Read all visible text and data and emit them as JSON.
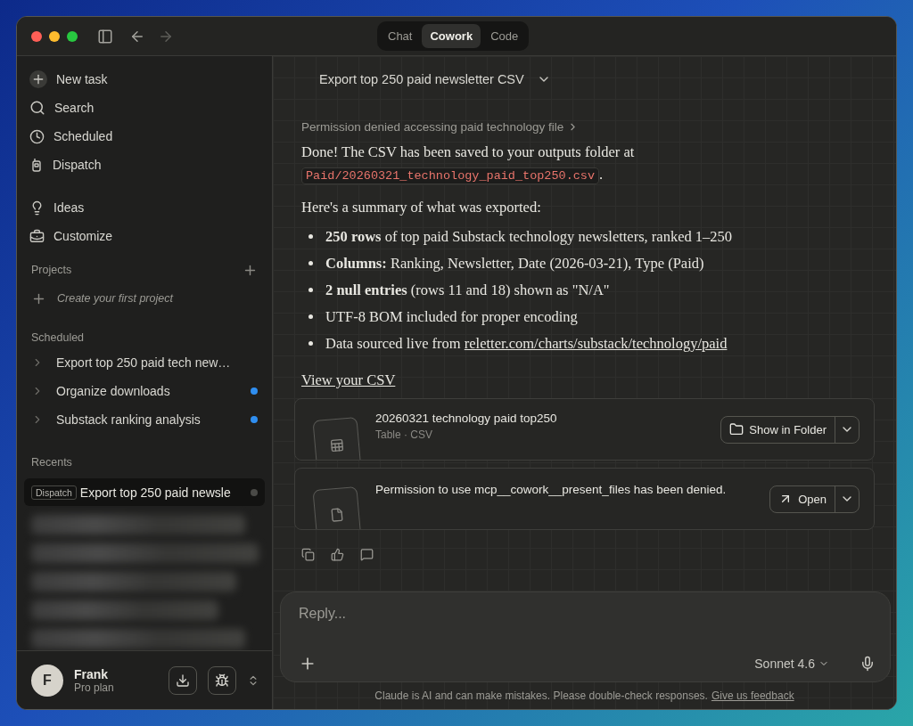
{
  "mode_tabs": [
    {
      "label": "Chat",
      "selected": false
    },
    {
      "label": "Cowork",
      "selected": true
    },
    {
      "label": "Code",
      "selected": false
    }
  ],
  "sidebar": {
    "actions": [
      {
        "label": "New task",
        "kind": "new"
      },
      {
        "label": "Search",
        "kind": "search"
      },
      {
        "label": "Scheduled",
        "kind": "clock"
      },
      {
        "label": "Dispatch",
        "kind": "dispatch"
      },
      {
        "label": "Ideas",
        "kind": "ideas"
      },
      {
        "label": "Customize",
        "kind": "customize"
      }
    ],
    "projects": {
      "heading": "Projects",
      "empty": "Create your first project"
    },
    "scheduled": {
      "heading": "Scheduled",
      "items": [
        {
          "label": "Export top 250 paid tech new…",
          "unread": false
        },
        {
          "label": "Organize downloads",
          "unread": true
        },
        {
          "label": "Substack ranking analysis",
          "unread": true
        }
      ]
    },
    "recents": {
      "heading": "Recents",
      "items": [
        {
          "tag": "Dispatch",
          "label": "Export top 250 paid newsle",
          "selected": true
        }
      ]
    },
    "user": {
      "initial": "F",
      "name": "Frank",
      "plan": "Pro plan"
    }
  },
  "conversation": {
    "title": "Export top 250 paid newsletter CSV",
    "tool_note": "Permission denied accessing paid technology file",
    "intro": "Done! The CSV has been saved to your outputs folder at",
    "path": "Paid/20260321_technology_paid_top250.csv",
    "path_end": ".",
    "summary": "Here's a summary of what was exported:",
    "bullets": [
      "**250 rows** of top paid Substack technology newsletters, ranked 1–250",
      "**Columns:** Ranking, Newsletter, Date (2026-03-21), Type (Paid)",
      "**2 null entries** (rows 11 and 18) shown as \"N/A\"",
      "UTF-8 BOM included for proper encoding"
    ],
    "source_prefix": "Data sourced live from",
    "source_link": "reletter.com/charts/substack/technology/paid",
    "view_link": "View your CSV",
    "files": [
      {
        "kind": "table",
        "name": "20260321 technology paid top250",
        "meta": "Table · CSV",
        "action": "Show in Folder"
      },
      {
        "kind": "file",
        "name": "Permission to use mcp__cowork__present_files has been denied.",
        "action": "Open"
      }
    ]
  },
  "composer": {
    "placeholder": "Reply...",
    "model": "Sonnet 4.6"
  },
  "footer": {
    "notice": "Claude is AI and can make mistakes. Please double-check responses.",
    "link": "Give us feedback"
  }
}
